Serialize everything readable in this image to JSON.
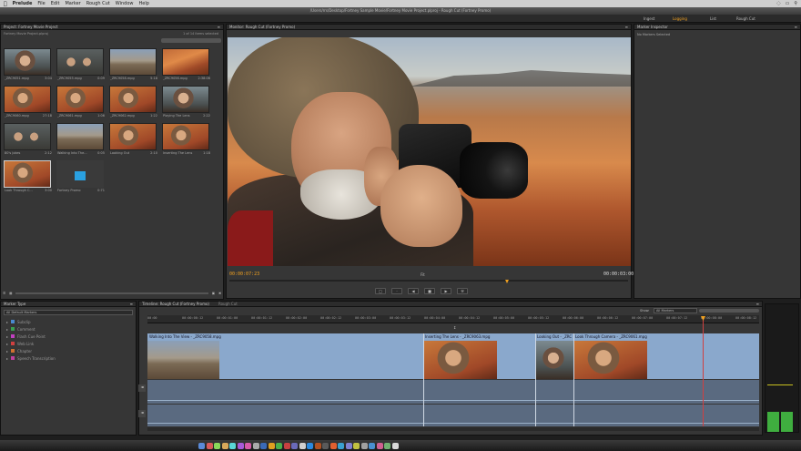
{
  "menubar": {
    "app": "Prelude",
    "items": [
      "File",
      "Edit",
      "Marker",
      "Rough Cut",
      "Window",
      "Help"
    ]
  },
  "title": "/Users/rrs/Desktop/Fortney Sample Movie/Fortney Movie Project.plproj - Rough Cut (Fortney Promo)",
  "workspace": {
    "tabs": [
      "Ingest",
      "Logging",
      "List",
      "Rough Cut"
    ],
    "active": "Logging"
  },
  "project": {
    "tab": "Project: Fortney Movie Project",
    "folder": "Fortney Movie Project.plproj",
    "count": "1 of 14 items selected",
    "items": [
      {
        "name": "_ZRC9051.mpg",
        "dur": "3:04",
        "style": "person"
      },
      {
        "name": "_ZRC9055.mpg",
        "dur": "0:09",
        "style": "group"
      },
      {
        "name": "_ZRC9058.mpg",
        "dur": "5:18",
        "style": "scenic"
      },
      {
        "name": "_ZRC9056.mpg",
        "dur": "2:38:06",
        "style": "hoodoo"
      },
      {
        "name": "_ZRC9060.mpg",
        "dur": "27:18",
        "style": "person2"
      },
      {
        "name": "_ZRC9061.mpg",
        "dur": "1:06",
        "style": "person2"
      },
      {
        "name": "_ZRC9062.mpg",
        "dur": "1:22",
        "style": "person2"
      },
      {
        "name": "Playing The Lens",
        "dur": "2:22",
        "style": "person"
      },
      {
        "name": "80's jokes",
        "dur": "2:12",
        "style": "group"
      },
      {
        "name": "Walking Into The...",
        "dur": "0:05",
        "style": "scenic"
      },
      {
        "name": "Looking Out",
        "dur": "2:10",
        "style": "person2"
      },
      {
        "name": "Inserting The Lens",
        "dur": "1:18",
        "style": "person2"
      },
      {
        "name": "Look Through C...",
        "dur": "3:00",
        "style": "person2"
      },
      {
        "name": "Fortney Promo",
        "dur": "0:71",
        "style": "promo"
      }
    ]
  },
  "monitor": {
    "tab": "Monitor: Rough Cut (Fortney Promo)",
    "timecode_left": "00:00:07:23",
    "timecode_right": "00:00:03:00",
    "zoom": "Fit"
  },
  "inspector": {
    "tab": "Marker Inspector",
    "empty": "No Markers Selected"
  },
  "marker_type": {
    "tab": "Marker Type",
    "dropdown": "All Default Markers",
    "items": [
      {
        "label": "Subclip",
        "color": "#4a8ad0"
      },
      {
        "label": "Comment",
        "color": "#3aa050"
      },
      {
        "label": "Flash Cue Point",
        "color": "#c040c0"
      },
      {
        "label": "Web Link",
        "color": "#d04040"
      },
      {
        "label": "Chapter",
        "color": "#d07030"
      },
      {
        "label": "Speech Transcription",
        "color": "#c040a0"
      }
    ]
  },
  "timeline": {
    "tab": "Timeline: Rough Cut (Fortney Promo)",
    "tab2": "Rough Cut",
    "show_label": "Show:",
    "show_value": "All Markers",
    "ticks": [
      "00:00",
      "00:00:00:12",
      "00:00:01:00",
      "00:00:01:12",
      "00:00:02:00",
      "00:00:02:12",
      "00:00:03:00",
      "00:00:03:12",
      "00:00:04:00",
      "00:00:04:12",
      "00:00:05:00",
      "00:00:05:12",
      "00:00:06:00",
      "00:00:06:12",
      "00:00:07:00",
      "00:00:07:12",
      "00:00:08:00",
      "00:00:08:12"
    ],
    "clips": [
      "Walking Into The View - _ZRC9058.mpg",
      "Inserting The Lens - _ZRC9063.mpg",
      "Looking Out - _ZRC",
      "Look Through Camera - _ZRC9061.mpg"
    ]
  }
}
